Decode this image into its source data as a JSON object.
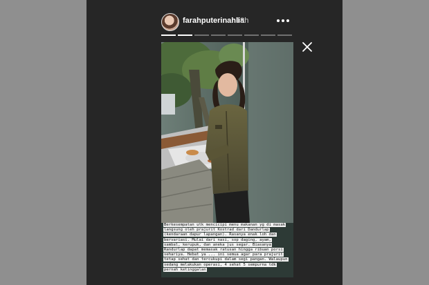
{
  "header": {
    "username": "farahputerinahlia",
    "time_ago": "18h",
    "more_icon": "more-horizontal-icon",
    "close_icon": "close-icon"
  },
  "story": {
    "segments_total": 8,
    "active_segment": 2,
    "caption": "Berkesempatan utk mencicipi menu makanan yg di masak langsung oleh prajurit Kostrad dari Dandurlap (kendaraan dapur lapangan). Rasanya enak loh dan bervariasi. Mulai dari nasi, sop daging, ayam, sambal, kerupuk, dan aneka jus segar. Biasanya Randurlap dapat memasak ratusan hingga ribuan porsi sehariya. Hebat ya ... ini semua agar para prajurit tetap sehat dan tercukupi dalam segi pangan. Walaupun sedang melakukan operasi, 4 sehat 5 sempurna tdk pernah ketinggalan"
  },
  "colors": {
    "page_bg": "#8f8f8f",
    "stage_bg": "#262626",
    "jacket": "#5a5536"
  }
}
